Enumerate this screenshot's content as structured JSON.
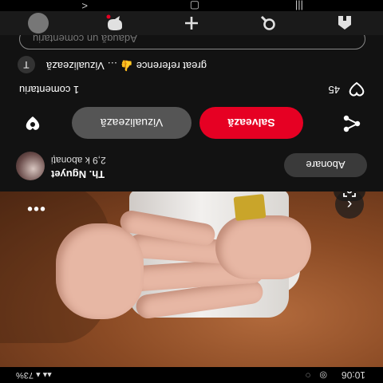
{
  "status_bar": {
    "time": "10:06",
    "battery": "73%",
    "signal": "▴▴ ▴"
  },
  "photo": {
    "menu_icon": "more-horizontal-icon",
    "back_icon": "chevron-left-icon",
    "lens_icon": "visual-search-icon"
  },
  "creator": {
    "name": "Th. Nguyet",
    "followers": "2,9 k abonați",
    "follow_label": "Abonare"
  },
  "actions": {
    "save_label": "Salvează",
    "visit_label": "Vizualizează",
    "share_icon": "share-icon",
    "reaction_icon": "reaction-icon",
    "accent_color": "#e60023"
  },
  "comments": {
    "count_label": "1 comentariu",
    "likes": "45",
    "comment_author_initial": "T",
    "comment_text": "great reference 👍 … Vizualizează",
    "input_placeholder": "Adaugă un comentariu"
  },
  "bottom_nav": {
    "items": [
      "home-icon",
      "search-icon",
      "add-icon",
      "messages-icon",
      "profile-icon"
    ]
  }
}
